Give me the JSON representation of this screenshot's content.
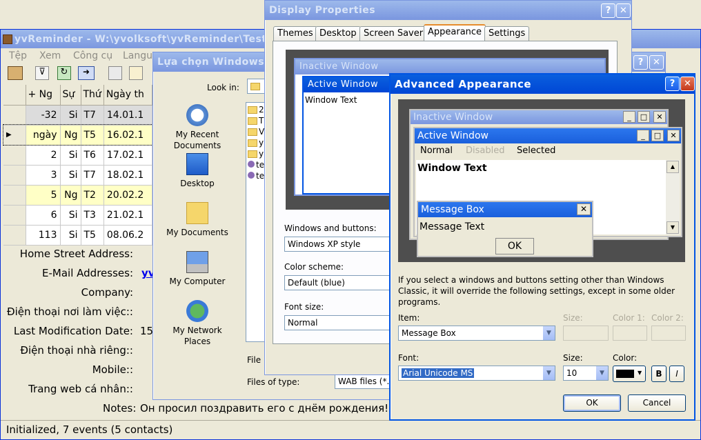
{
  "main": {
    "title": "yvReminder - W:\\yvolksoft\\yvReminder\\Test\\t",
    "menu": [
      "Tệp",
      "Xem",
      "Công cụ",
      "Langu"
    ],
    "grid_headers": [
      "+ Ng",
      "Sự",
      "Thứ",
      "Ngày th"
    ],
    "rows": [
      [
        "-32",
        "Si",
        "T7",
        "14.01.1"
      ],
      [
        "ngày",
        "Ng",
        "T5",
        "16.02.1"
      ],
      [
        "2",
        "Si",
        "T6",
        "17.02.1"
      ],
      [
        "3",
        "Si",
        "T7",
        "18.02.1"
      ],
      [
        "5",
        "Ng",
        "T2",
        "20.02.2"
      ],
      [
        "6",
        "Si",
        "T3",
        "21.02.1"
      ],
      [
        "113",
        "Si",
        "T5",
        "08.06.2"
      ]
    ],
    "detail_labels": [
      "Home Street Address:",
      "E-Mail Addresses:",
      "Company:",
      "Điện thoại nơi làm việc::",
      "Last Modification Date:",
      "Điện thoại nhà riêng::",
      "Mobile::",
      "Trang web cá nhân::"
    ],
    "email_value": "yv",
    "modification_value": "15",
    "notes_label": "Notes:",
    "notes_value": "Он просил поздравить его с днём рождения!",
    "status": "Initialized, 7 events (5 contacts)"
  },
  "file_dialog": {
    "title": "Lựa chọn Windows",
    "look_in_label": "Look in:",
    "places": [
      "My Recent Documents",
      "Desktop",
      "My Documents",
      "My Computer",
      "My Network Places"
    ],
    "files": [
      "2",
      "T",
      "V",
      "y",
      "y",
      "te",
      "te"
    ],
    "file_name_label": "File",
    "files_of_type_label": "Files of type:",
    "files_of_type_value": "WAB files (*.w"
  },
  "display_props": {
    "title": "Display Properties",
    "tabs": [
      "Themes",
      "Desktop",
      "Screen Saver",
      "Appearance",
      "Settings"
    ],
    "selected_tab": "Appearance",
    "preview_inactive": "Inactive Window",
    "preview_active": "Active Window",
    "preview_text": "Window Text",
    "windows_buttons_label": "Windows and buttons:",
    "windows_buttons_value": "Windows XP style",
    "color_scheme_label": "Color scheme:",
    "color_scheme_value": "Default (blue)",
    "font_size_label": "Font size:",
    "font_size_value": "Normal"
  },
  "advanced": {
    "title": "Advanced Appearance",
    "preview_inactive": "Inactive Window",
    "preview_active": "Active Window",
    "menu_normal": "Normal",
    "menu_disabled": "Disabled",
    "menu_selected": "Selected",
    "window_text": "Window Text",
    "msgbox_title": "Message Box",
    "msgbox_text": "Message Text",
    "msgbox_ok": "OK",
    "info": "If you select a windows and buttons setting other than Windows Classic, it will override the following settings, except in some older programs.",
    "item_label": "Item:",
    "item_value": "Message Box",
    "size_label": "Size:",
    "color1_label": "Color 1:",
    "color2_label": "Color 2:",
    "font_label": "Font:",
    "font_value": "Arial Unicode MS",
    "font_size_label": "Size:",
    "font_size_value": "10",
    "color_label": "Color:",
    "bold": "B",
    "italic": "I",
    "ok": "OK",
    "cancel": "Cancel"
  },
  "colors": {
    "xp_blue": "#0054e3",
    "selection": "#316ac5",
    "highlight_row": "#ffffc6"
  }
}
